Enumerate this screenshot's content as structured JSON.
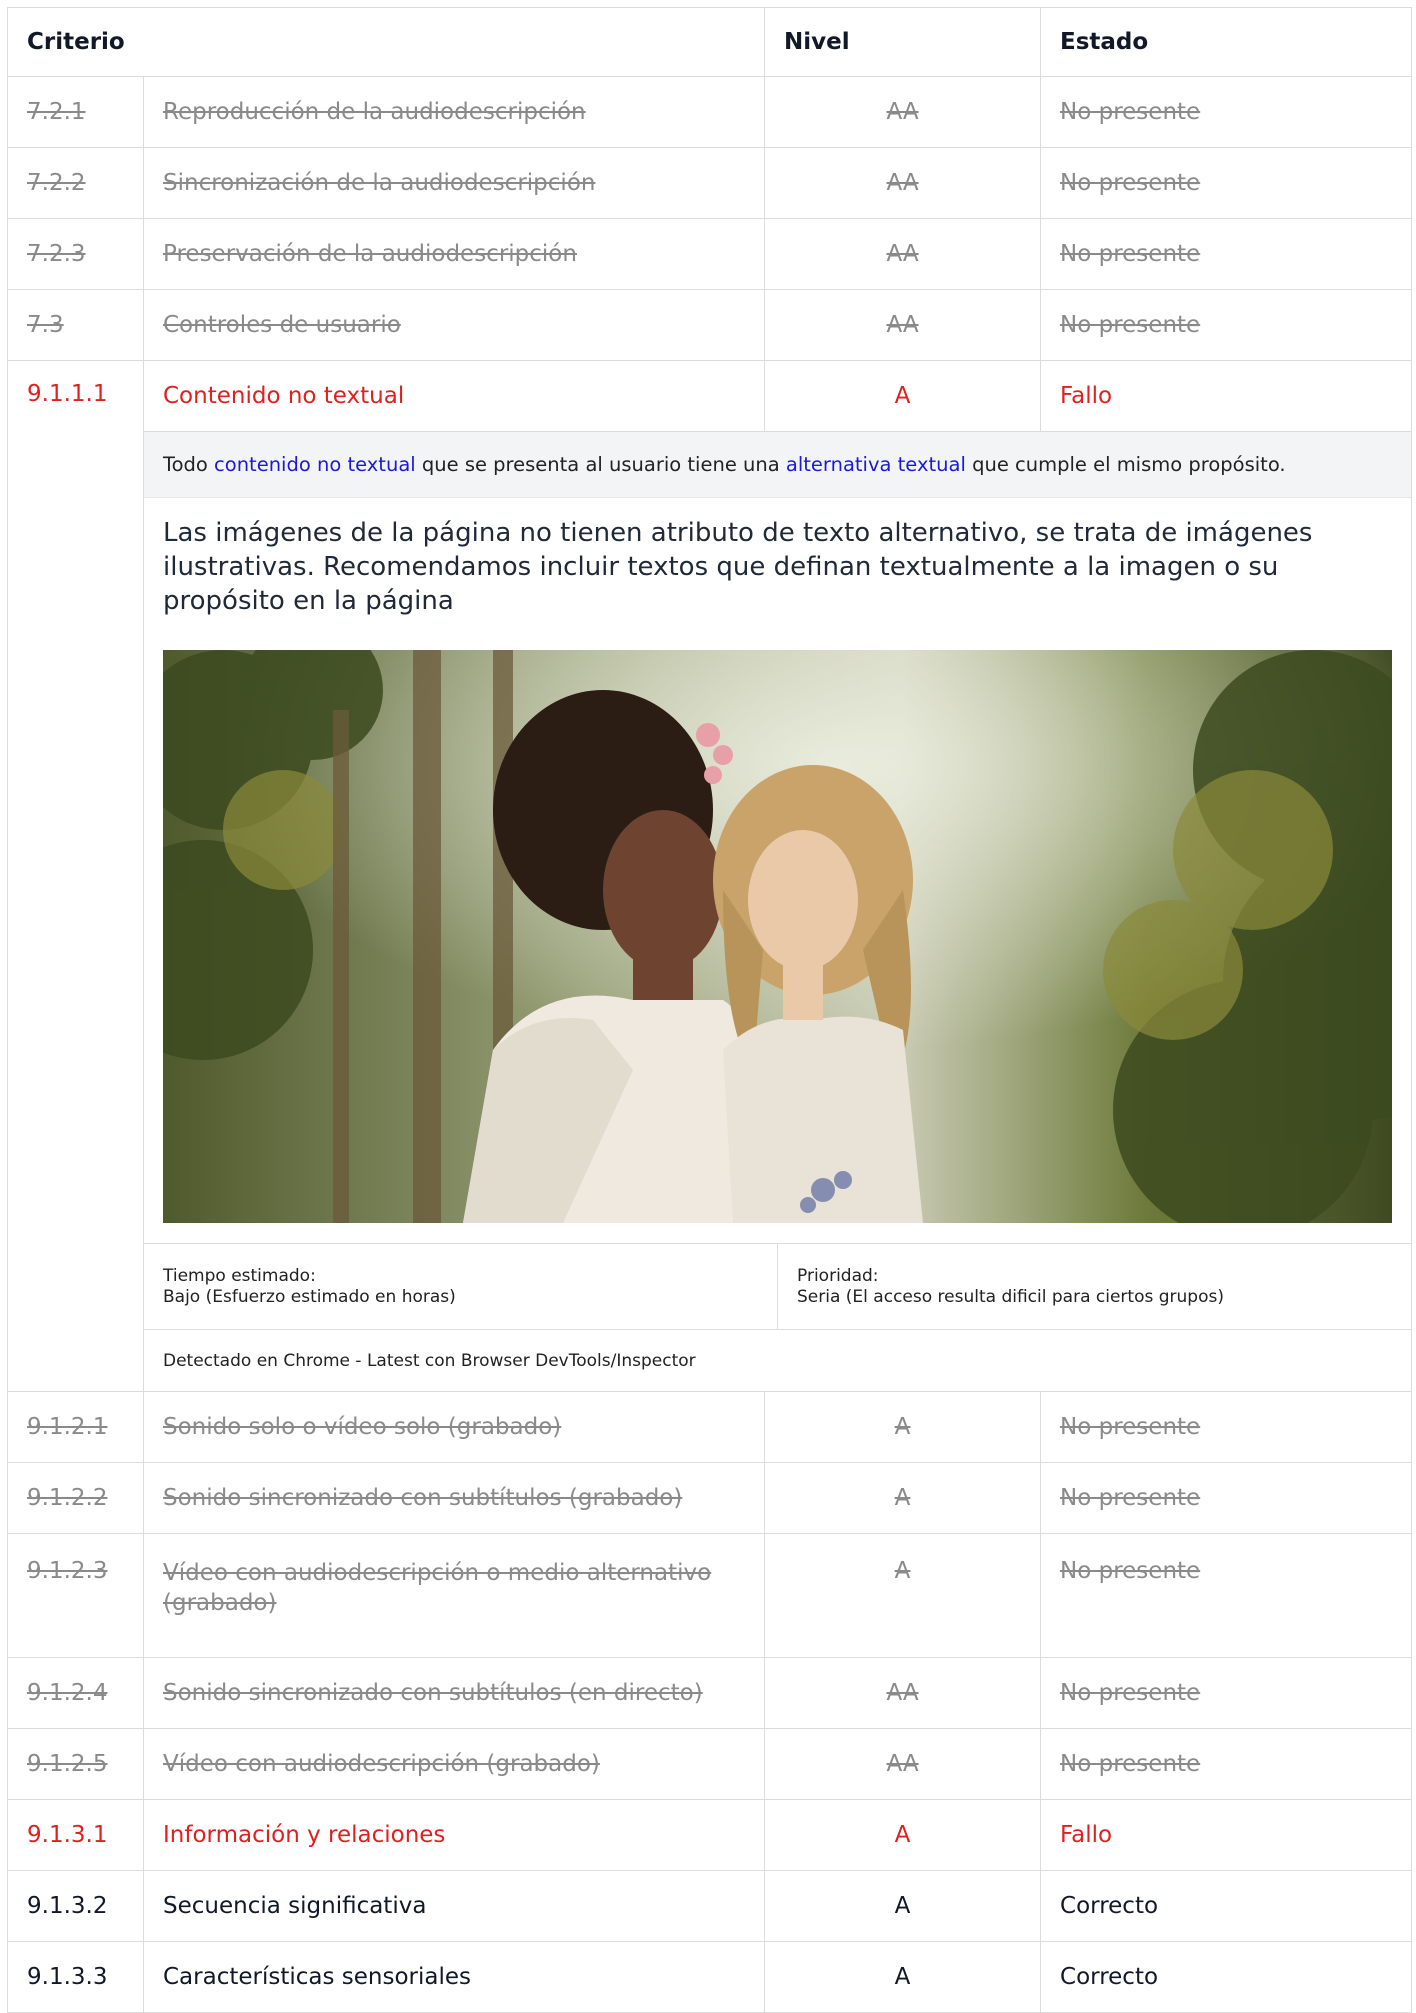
{
  "header": {
    "criterio": "Criterio",
    "nivel": "Nivel",
    "estado": "Estado"
  },
  "rows_top": [
    {
      "id": "7.2.1",
      "name": "Reproducción de la audiodescripción",
      "level": "AA",
      "status": "No presente"
    },
    {
      "id": "7.2.2",
      "name": "Sincronización de la audiodescripción",
      "level": "AA",
      "status": "No presente"
    },
    {
      "id": "7.2.3",
      "name": "Preservación de la audiodescripción",
      "level": "AA",
      "status": "No presente"
    },
    {
      "id": "7.3",
      "name": "Controles de usuario",
      "level": "AA",
      "status": "No presente"
    }
  ],
  "fail_row": {
    "id": "9.1.1.1",
    "name": "Contenido no textual",
    "level": "A",
    "status": "Fallo"
  },
  "detail": {
    "desc_pre": "Todo ",
    "desc_link1": "contenido no textual",
    "desc_mid": " que se presenta al usuario tiene una ",
    "desc_link2": "alternativa textual",
    "desc_post": " que cumple el mismo propósito.",
    "note": "Las imágenes de la página no tienen atributo de texto alternativo, se trata de imágenes ilustrativas. Recomendamos incluir textos que definan textualmente a la imagen o su propósito en la página",
    "time_label": "Tiempo estimado:",
    "time_value": "Bajo (Esfuerzo estimado en horas)",
    "priority_label": "Prioridad:",
    "priority_value": "Seria (El acceso resulta dificil para ciertos grupos)",
    "detected": "Detectado en Chrome - Latest con Browser DevTools/Inspector"
  },
  "rows_bottom": [
    {
      "id": "9.1.2.1",
      "name": "Sonido solo o vídeo solo (grabado)",
      "level": "A",
      "status": "No presente",
      "kind": "np"
    },
    {
      "id": "9.1.2.2",
      "name": "Sonido sincronizado con subtítulos (grabado)",
      "level": "A",
      "status": "No presente",
      "kind": "np"
    },
    {
      "id": "9.1.2.3",
      "name": "Vídeo con audiodescripción o medio alternativo (grabado)",
      "level": "A",
      "status": "No presente",
      "kind": "np"
    },
    {
      "id": "9.1.2.4",
      "name": "Sonido sincronizado con subtítulos (en directo)",
      "level": "AA",
      "status": "No presente",
      "kind": "np"
    },
    {
      "id": "9.1.2.5",
      "name": "Vídeo con audiodescripción (grabado)",
      "level": "AA",
      "status": "No presente",
      "kind": "np"
    },
    {
      "id": "9.1.3.1",
      "name": "Información y relaciones",
      "level": "A",
      "status": "Fallo",
      "kind": "fail"
    },
    {
      "id": "9.1.3.2",
      "name": "Secuencia significativa",
      "level": "A",
      "status": "Correcto",
      "kind": "ok"
    },
    {
      "id": "9.1.3.3",
      "name": "Características sensoriales",
      "level": "A",
      "status": "Correcto",
      "kind": "ok"
    }
  ],
  "colors": {
    "fail": "#e01f1f",
    "link": "#1a1ad8",
    "muted": "#8a8a8a",
    "detail_bg": "#f3f4f6"
  }
}
